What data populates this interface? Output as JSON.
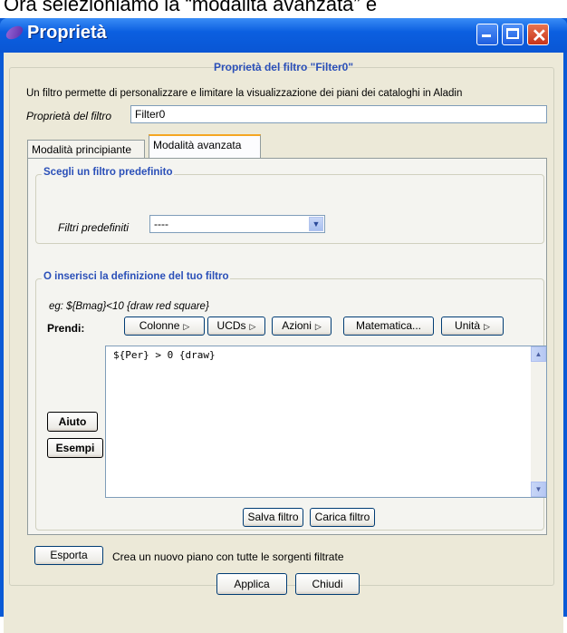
{
  "caption": "Ora selezioniamo la “modalità avanzata” e",
  "window": {
    "title": "Proprietà",
    "icon": "aladin-logo-icon"
  },
  "dialog": {
    "heading": "Proprietà del filtro \"Filter0\"",
    "description": "Un filtro permette di personalizzare e limitare la visualizzazione dei piani dei cataloghi in Aladin",
    "name_label": "Proprietà del filtro",
    "name_value": "Filter0"
  },
  "tabs": [
    {
      "label": "Modalità principiante",
      "active": false
    },
    {
      "label": "Modalità avanzata",
      "active": true
    }
  ],
  "predefined": {
    "group_title": "Scegli un filtro predefinito",
    "label": "Filtri predefiniti",
    "selected": "----"
  },
  "definition": {
    "group_title": "O inserisci la definizione del tuo filtro",
    "example": "eg: ${Bmag}<10 {draw red square}",
    "take_label": "Prendi:",
    "buttons": {
      "columns": "Colonne",
      "ucds": "UCDs",
      "actions": "Azioni",
      "math": "Matematica...",
      "units": "Unità"
    },
    "code": "${Per} > 0 {draw}",
    "help": "Aiuto",
    "examples": "Esempi",
    "save": "Salva filtro",
    "load": "Carica filtro"
  },
  "export": {
    "button": "Esporta",
    "description": "Crea un nuovo piano con tutte le sorgenti filtrate"
  },
  "footer": {
    "apply": "Applica",
    "close": "Chiudi"
  }
}
